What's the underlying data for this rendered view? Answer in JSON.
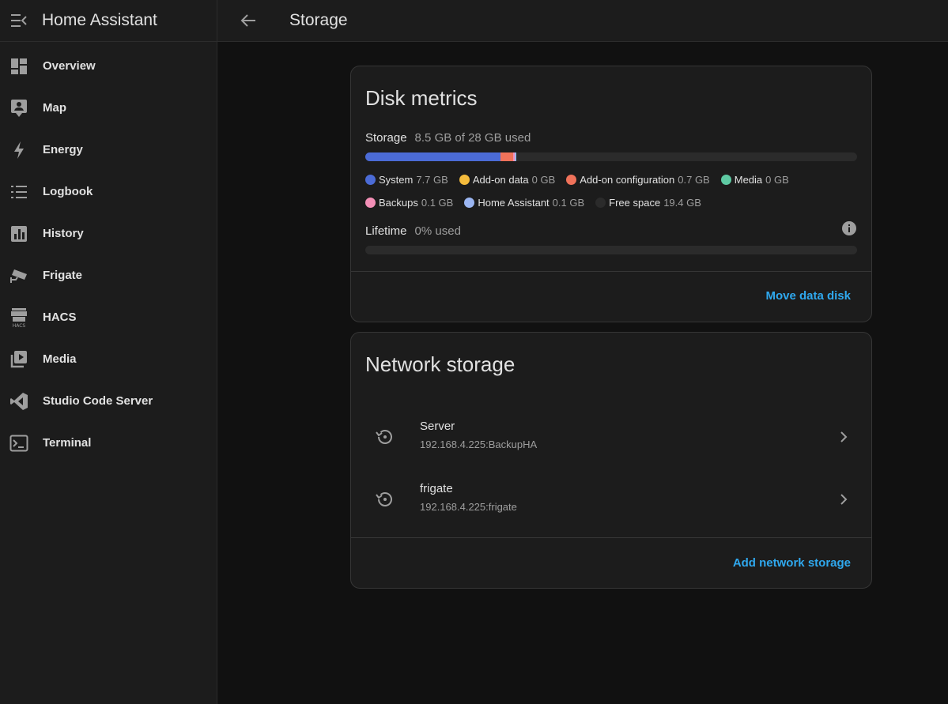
{
  "sidebar": {
    "title": "Home Assistant",
    "items": [
      {
        "label": "Overview",
        "icon": "dashboard-icon"
      },
      {
        "label": "Map",
        "icon": "map-account-icon"
      },
      {
        "label": "Energy",
        "icon": "lightning-bolt-icon"
      },
      {
        "label": "Logbook",
        "icon": "format-list-icon"
      },
      {
        "label": "History",
        "icon": "chart-box-icon"
      },
      {
        "label": "Frigate",
        "icon": "cctv-icon"
      },
      {
        "label": "HACS",
        "icon": "hacs-icon"
      },
      {
        "label": "Media",
        "icon": "play-box-multiple-icon"
      },
      {
        "label": "Studio Code Server",
        "icon": "vscode-icon"
      },
      {
        "label": "Terminal",
        "icon": "console-icon"
      }
    ]
  },
  "header": {
    "title": "Storage"
  },
  "disk_metrics": {
    "title": "Disk metrics",
    "storage_label": "Storage",
    "storage_value": "8.5 GB of 28 GB used",
    "storage_bar": [
      {
        "name": "System",
        "gb": 7.7,
        "color": "#4b6bd6"
      },
      {
        "name": "Add-on data",
        "gb": 0,
        "color": "#f4bb3c"
      },
      {
        "name": "Add-on configuration",
        "gb": 0.7,
        "color": "#f0725a"
      },
      {
        "name": "Media",
        "gb": 0,
        "color": "#5ecaa3"
      },
      {
        "name": "Backups",
        "gb": 0.1,
        "color": "#f38fb6"
      },
      {
        "name": "Home Assistant",
        "gb": 0.1,
        "color": "#9bb6f2"
      }
    ],
    "total_gb": 28,
    "legend_row1": [
      {
        "name": "System",
        "value": "7.7 GB",
        "color": "#4b6bd6"
      },
      {
        "name": "Add-on data",
        "value": "0 GB",
        "color": "#f4bb3c"
      },
      {
        "name": "Add-on configuration",
        "value": "0.7 GB",
        "color": "#f0725a"
      },
      {
        "name": "Media",
        "value": "0 GB",
        "color": "#5ecaa3"
      }
    ],
    "legend_row2": [
      {
        "name": "Backups",
        "value": "0.1 GB",
        "color": "#f38fb6"
      },
      {
        "name": "Home Assistant",
        "value": "0.1 GB",
        "color": "#9bb6f2"
      },
      {
        "name": "Free space",
        "value": "19.4 GB",
        "color": "#2b2b2b"
      }
    ],
    "lifetime_label": "Lifetime",
    "lifetime_value": "0% used",
    "lifetime_percent": 0,
    "action": "Move data disk"
  },
  "network_storage": {
    "title": "Network storage",
    "mounts": [
      {
        "name": "Server",
        "address": "192.168.4.225:BackupHA"
      },
      {
        "name": "frigate",
        "address": "192.168.4.225:frigate"
      }
    ],
    "action": "Add network storage"
  }
}
